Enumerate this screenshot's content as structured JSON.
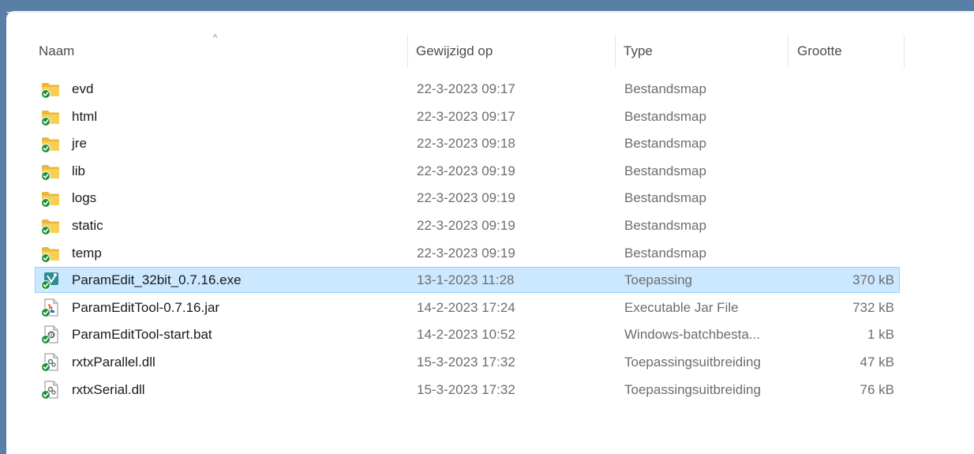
{
  "columns": {
    "name": "Naam",
    "modified": "Gewijzigd op",
    "type": "Type",
    "size": "Grootte",
    "sort_indicator": "^"
  },
  "files": [
    {
      "name": "evd",
      "modified": "22-3-2023 09:17",
      "type": "Bestandsmap",
      "size": "",
      "icon": "folder-icon",
      "selected": false
    },
    {
      "name": "html",
      "modified": "22-3-2023 09:17",
      "type": "Bestandsmap",
      "size": "",
      "icon": "folder-icon",
      "selected": false
    },
    {
      "name": "jre",
      "modified": "22-3-2023 09:18",
      "type": "Bestandsmap",
      "size": "",
      "icon": "folder-icon",
      "selected": false
    },
    {
      "name": "lib",
      "modified": "22-3-2023 09:19",
      "type": "Bestandsmap",
      "size": "",
      "icon": "folder-icon",
      "selected": false
    },
    {
      "name": "logs",
      "modified": "22-3-2023 09:19",
      "type": "Bestandsmap",
      "size": "",
      "icon": "folder-icon",
      "selected": false
    },
    {
      "name": "static",
      "modified": "22-3-2023 09:19",
      "type": "Bestandsmap",
      "size": "",
      "icon": "folder-icon",
      "selected": false
    },
    {
      "name": "temp",
      "modified": "22-3-2023 09:19",
      "type": "Bestandsmap",
      "size": "",
      "icon": "folder-icon",
      "selected": false
    },
    {
      "name": "ParamEdit_32bit_0.7.16.exe",
      "modified": "13-1-2023 11:28",
      "type": "Toepassing",
      "size": "370 kB",
      "icon": "application-icon",
      "selected": true
    },
    {
      "name": "ParamEditTool-0.7.16.jar",
      "modified": "14-2-2023 17:24",
      "type": "Executable Jar File",
      "size": "732 kB",
      "icon": "jar-file-icon",
      "selected": false
    },
    {
      "name": "ParamEditTool-start.bat",
      "modified": "14-2-2023 10:52",
      "type": "Windows-batchbesta...",
      "size": "1 kB",
      "icon": "batch-file-icon",
      "selected": false
    },
    {
      "name": "rxtxParallel.dll",
      "modified": "15-3-2023 17:32",
      "type": "Toepassingsuitbreiding",
      "size": "47 kB",
      "icon": "dll-file-icon",
      "selected": false
    },
    {
      "name": "rxtxSerial.dll",
      "modified": "15-3-2023 17:32",
      "type": "Toepassingsuitbreiding",
      "size": "76 kB",
      "icon": "dll-file-icon",
      "selected": false
    }
  ],
  "colors": {
    "selection_bg": "#cce8ff",
    "selection_border": "#99d1ff",
    "folder": "#f4c442",
    "sync_badge": "#1f8f3a"
  }
}
